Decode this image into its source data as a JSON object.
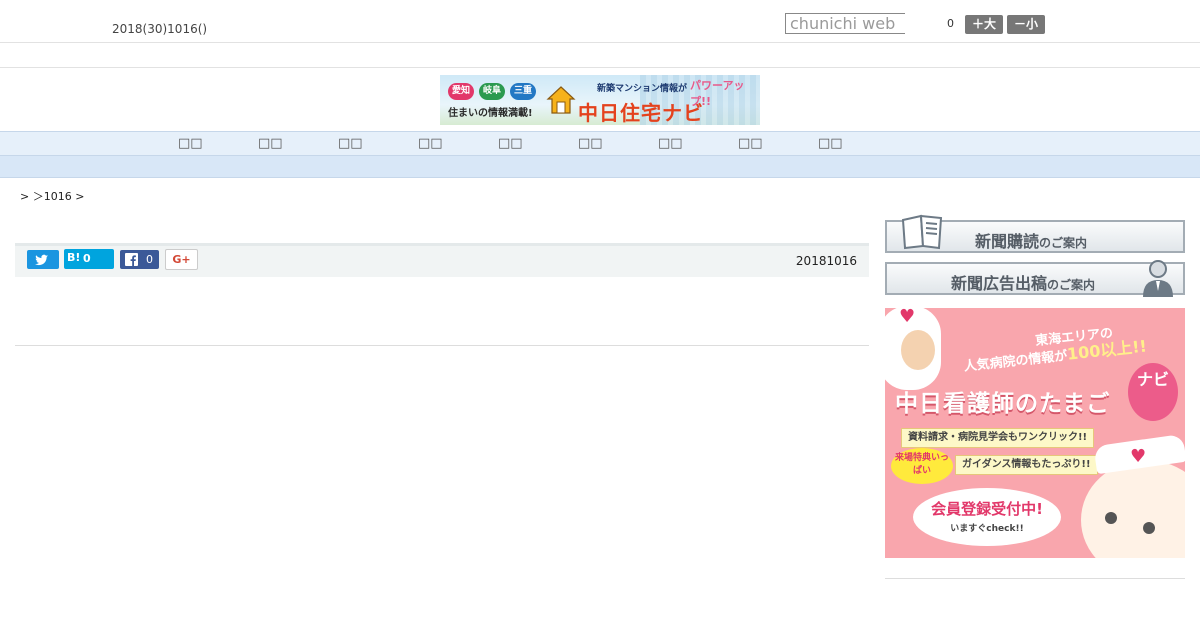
{
  "header": {
    "date": "2018(30)1016()",
    "search_placeholder": "chunichi web",
    "count": "0",
    "font_larger": "＋大",
    "font_smaller": "－小"
  },
  "banner": {
    "regions": [
      "愛知",
      "岐阜",
      "三重"
    ],
    "tagline": "住まいの情報満載!",
    "headline": "新築マンション情報が",
    "power_up": "パワーアップ!!",
    "title": "中日住宅ナビ"
  },
  "nav": {
    "items": [
      " ",
      " ",
      " ",
      " ",
      " ",
      " ",
      " ",
      " ",
      " "
    ]
  },
  "breadcrumb": "> ＞1016 >",
  "share": {
    "hatena_label": "B!",
    "hatena_count": "0",
    "facebook_count": "0",
    "gplus_label": "G+"
  },
  "article": {
    "date": "20181016"
  },
  "sidebar": {
    "subscribe_main": "新聞購読",
    "subscribe_small": "のご案内",
    "ads_main": "新聞広告出稿",
    "ads_small": "のご案内",
    "nurse_banner": {
      "line1": "東海エリアの",
      "line2": "人気病院の情報が",
      "line2_highlight": "100以上!!",
      "title": "中日看護師のたまご",
      "navi_badge": "ナビ",
      "strip1": "資料請求・病院見学会もワンクリック!!",
      "bubble": "来場特典いっぱい",
      "strip2": "ガイダンス情報もたっぷり!!",
      "cta_main": "会員登録受付中!",
      "cta_sub": "いますぐcheck!!"
    }
  }
}
